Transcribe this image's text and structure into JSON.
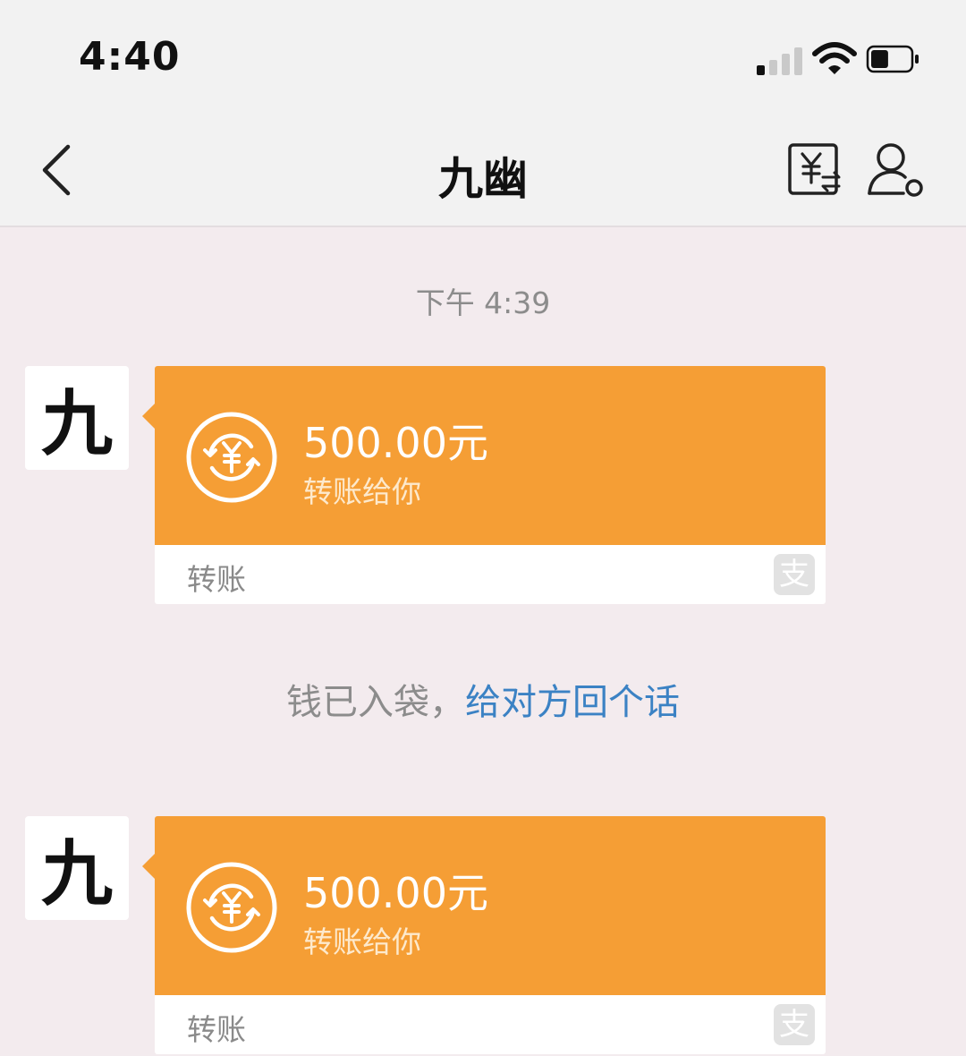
{
  "status_bar": {
    "time": "4:40",
    "signal_icon": "cellular-signal-icon",
    "wifi_icon": "wifi-icon",
    "battery_icon": "battery-icon",
    "battery_level": 0.45
  },
  "header": {
    "back_icon": "chevron-left-icon",
    "title": "九幽",
    "transfer_icon": "yuan-transfer-icon",
    "profile_icon": "user-settings-icon"
  },
  "chat": {
    "timestamp": "下午 4:39",
    "messages": [
      {
        "avatar_text": "九",
        "amount": "500.00元",
        "subtitle": "转账给你",
        "type_label": "转账",
        "card_icon": "yuan-exchange-icon",
        "brand_icon": "alipay-icon",
        "brand_glyph": "支"
      },
      {
        "avatar_text": "九",
        "amount": "500.00元",
        "subtitle": "转账给你",
        "type_label": "转账",
        "card_icon": "yuan-exchange-icon",
        "brand_icon": "alipay-icon",
        "brand_glyph": "支"
      }
    ],
    "notice": {
      "text": "钱已入袋，",
      "link": "给对方回个话"
    }
  },
  "colors": {
    "card_orange": "#f59e35",
    "link_blue": "#3b82c4",
    "chat_background": "#f3ebee"
  }
}
